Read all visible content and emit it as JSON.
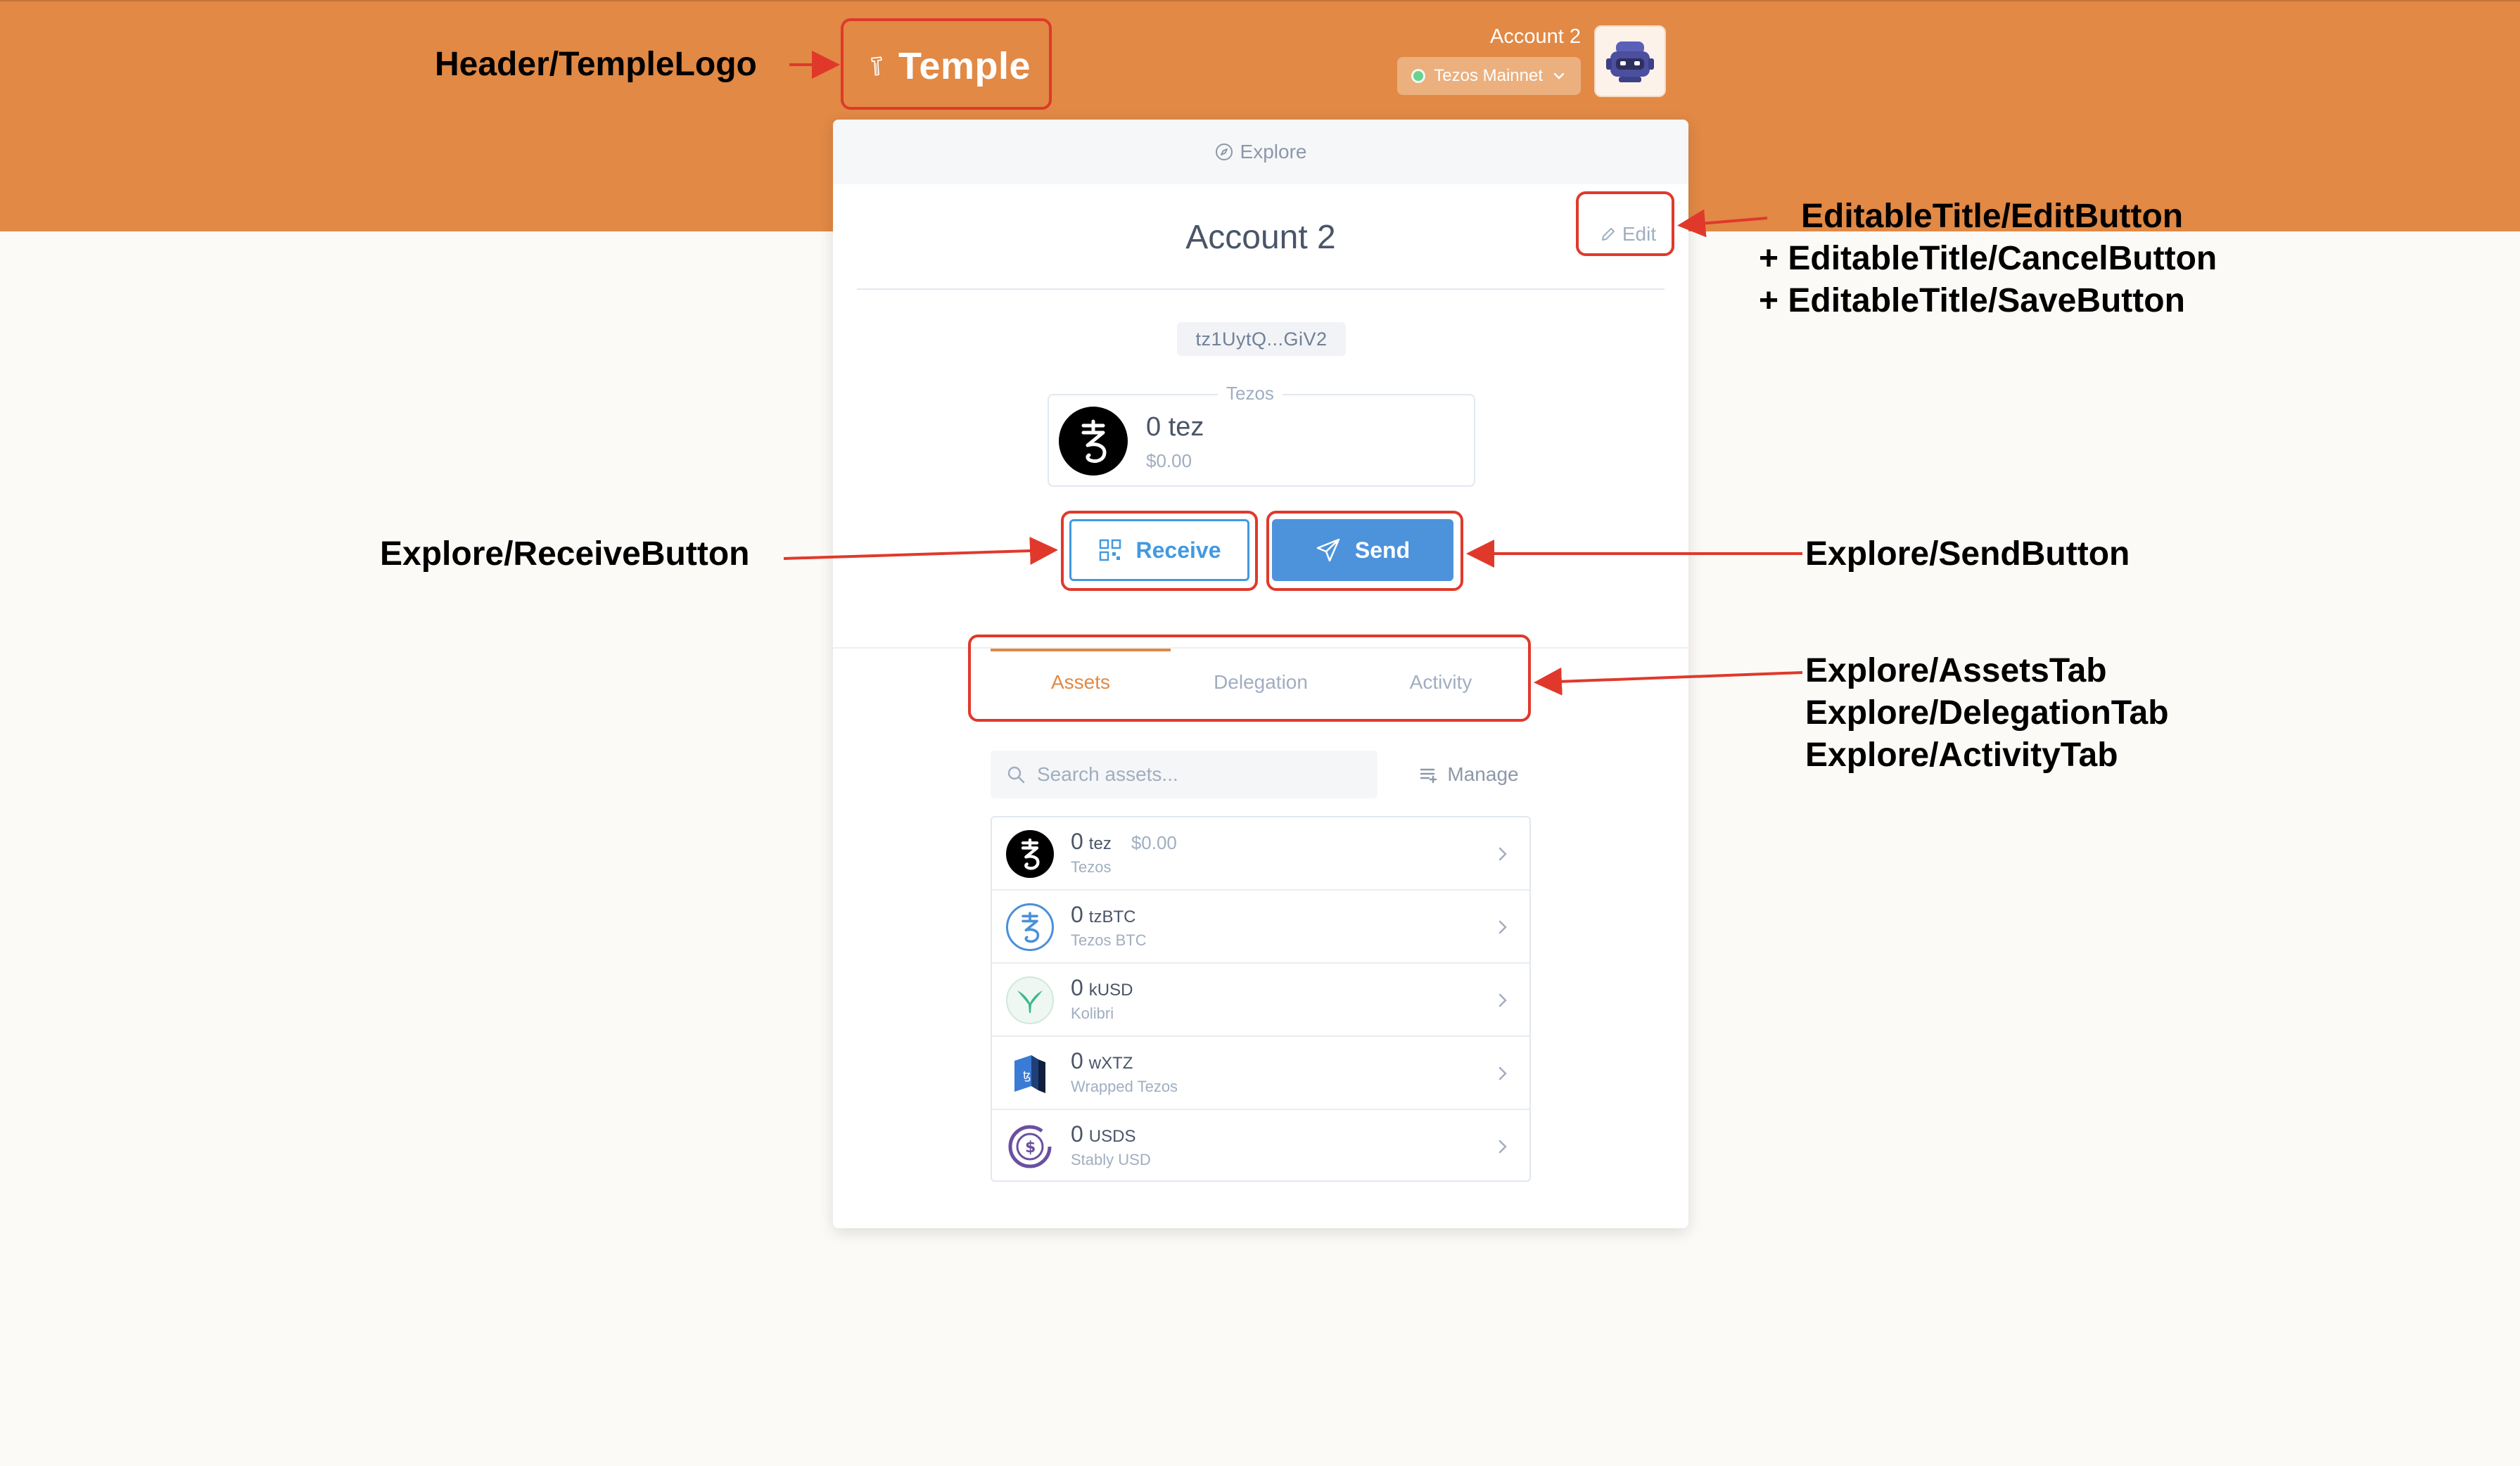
{
  "header": {
    "logo_text": "Temple",
    "account_name": "Account 2",
    "network_label": "Tezos Mainnet"
  },
  "explore": {
    "top_label": "Explore",
    "edit_label": "Edit",
    "title": "Account 2",
    "address": "tz1UytQ...GiV2",
    "balance_legend": "Tezos",
    "balance_amount": "0 tez",
    "balance_usd": "$0.00",
    "receive_label": "Receive",
    "send_label": "Send",
    "tabs": [
      {
        "label": "Assets",
        "active": true
      },
      {
        "label": "Delegation",
        "active": false
      },
      {
        "label": "Activity",
        "active": false
      }
    ],
    "search_placeholder": "Search assets...",
    "manage_label": "Manage",
    "assets": [
      {
        "amount": "0",
        "symbol": "tez",
        "usd": "$0.00",
        "name": "Tezos",
        "icon": "tezos-icon"
      },
      {
        "amount": "0",
        "symbol": "tzBTC",
        "usd": "",
        "name": "Tezos BTC",
        "icon": "tzbtc-icon"
      },
      {
        "amount": "0",
        "symbol": "kUSD",
        "usd": "",
        "name": "Kolibri",
        "icon": "kolibri-icon"
      },
      {
        "amount": "0",
        "symbol": "wXTZ",
        "usd": "",
        "name": "Wrapped Tezos",
        "icon": "wxtz-icon"
      },
      {
        "amount": "0",
        "symbol": "USDS",
        "usd": "",
        "name": "Stably USD",
        "icon": "usds-icon"
      }
    ]
  },
  "annotations": {
    "logo": "Header/TempleLogo",
    "edit_lines": [
      "EditableTitle/EditButton",
      "+  EditableTitle/CancelButton",
      "+  EditableTitle/SaveButton"
    ],
    "receive": "Explore/ReceiveButton",
    "send": "Explore/SendButton",
    "tab_lines": [
      "Explore/AssetsTab",
      "Explore/DelegationTab",
      "Explore/ActivityTab"
    ]
  },
  "colors": {
    "header_orange": "#e18945",
    "accent_blue": "#4299e1",
    "annotation_red": "#e0392b",
    "background": "#fcfaf6"
  }
}
